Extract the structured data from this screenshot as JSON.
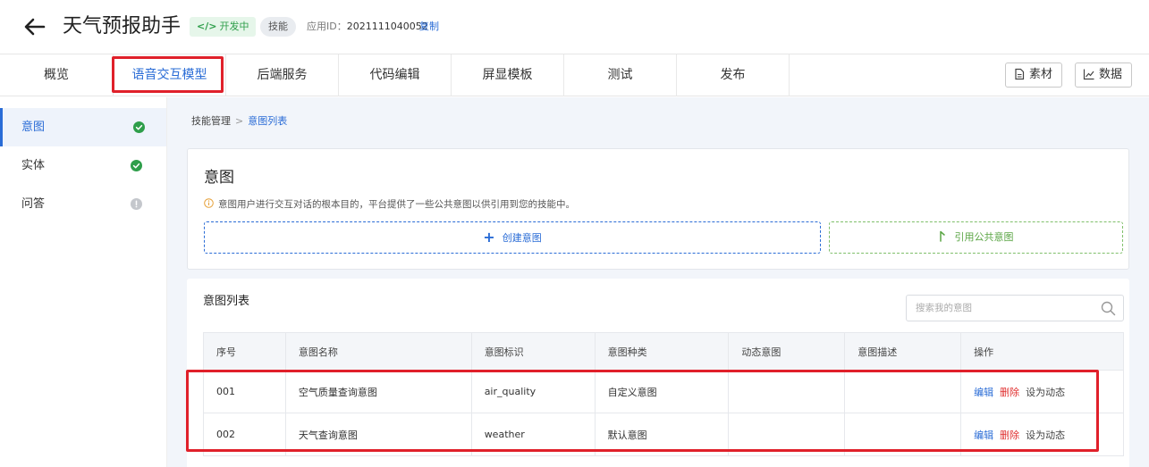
{
  "header": {
    "title": "天气预报助手",
    "status_badge": "开发中",
    "status_code_glyph": "</>",
    "skill_badge": "技能",
    "app_id_label": "应用ID：",
    "app_id_value": "2021111040052",
    "copy_label": "复制"
  },
  "tabs": [
    {
      "label": "概览"
    },
    {
      "label": "语音交互模型",
      "active": true
    },
    {
      "label": "后端服务"
    },
    {
      "label": "代码编辑"
    },
    {
      "label": "屏显模板"
    },
    {
      "label": "测试"
    },
    {
      "label": "发布"
    }
  ],
  "toolbar": {
    "assets_label": "素材",
    "data_label": "数据"
  },
  "sidebar": {
    "items": [
      {
        "label": "意图",
        "status": "done"
      },
      {
        "label": "实体",
        "status": "done"
      },
      {
        "label": "问答",
        "status": "pending"
      }
    ]
  },
  "breadcrumb": {
    "root": "技能管理",
    "sep": ">",
    "current": "意图列表"
  },
  "intent_card": {
    "title": "意图",
    "info": "意图用户进行交互对话的根本目的，平台提供了一些公共意图以供引用到您的技能中。",
    "create_label": "创建意图",
    "reference_label": "引用公共意图"
  },
  "list": {
    "title": "意图列表",
    "search_placeholder": "搜索我的意图",
    "columns": [
      "序号",
      "意图名称",
      "意图标识",
      "意图种类",
      "动态意图",
      "意图描述",
      "操作"
    ],
    "rows": [
      {
        "no": "001",
        "name": "空气质量查询意图",
        "id": "air_quality",
        "kind": "自定义意图",
        "dynamic": "",
        "desc": "",
        "edit": "编辑",
        "delete": "删除",
        "set_dynamic": "设为动态"
      },
      {
        "no": "002",
        "name": "天气查询意图",
        "id": "weather",
        "kind": "默认意图",
        "dynamic": "",
        "desc": "",
        "edit": "编辑",
        "delete": "删除",
        "set_dynamic": "设为动态"
      }
    ]
  },
  "colors": {
    "accent": "#2a6cd6",
    "success": "#2e9e4a",
    "danger": "#e03030",
    "highlight": "#e0202a"
  }
}
